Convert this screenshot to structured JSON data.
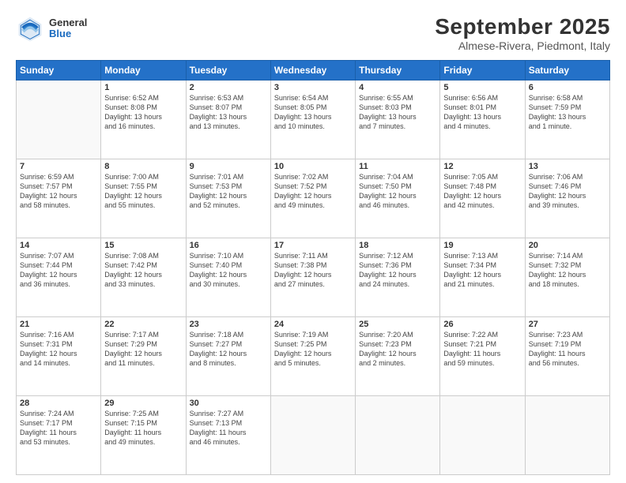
{
  "header": {
    "logo": {
      "general": "General",
      "blue": "Blue"
    },
    "title": "September 2025",
    "subtitle": "Almese-Rivera, Piedmont, Italy"
  },
  "days_of_week": [
    "Sunday",
    "Monday",
    "Tuesday",
    "Wednesday",
    "Thursday",
    "Friday",
    "Saturday"
  ],
  "weeks": [
    [
      {
        "day": "",
        "info": ""
      },
      {
        "day": "1",
        "info": "Sunrise: 6:52 AM\nSunset: 8:08 PM\nDaylight: 13 hours\nand 16 minutes."
      },
      {
        "day": "2",
        "info": "Sunrise: 6:53 AM\nSunset: 8:07 PM\nDaylight: 13 hours\nand 13 minutes."
      },
      {
        "day": "3",
        "info": "Sunrise: 6:54 AM\nSunset: 8:05 PM\nDaylight: 13 hours\nand 10 minutes."
      },
      {
        "day": "4",
        "info": "Sunrise: 6:55 AM\nSunset: 8:03 PM\nDaylight: 13 hours\nand 7 minutes."
      },
      {
        "day": "5",
        "info": "Sunrise: 6:56 AM\nSunset: 8:01 PM\nDaylight: 13 hours\nand 4 minutes."
      },
      {
        "day": "6",
        "info": "Sunrise: 6:58 AM\nSunset: 7:59 PM\nDaylight: 13 hours\nand 1 minute."
      }
    ],
    [
      {
        "day": "7",
        "info": "Sunrise: 6:59 AM\nSunset: 7:57 PM\nDaylight: 12 hours\nand 58 minutes."
      },
      {
        "day": "8",
        "info": "Sunrise: 7:00 AM\nSunset: 7:55 PM\nDaylight: 12 hours\nand 55 minutes."
      },
      {
        "day": "9",
        "info": "Sunrise: 7:01 AM\nSunset: 7:53 PM\nDaylight: 12 hours\nand 52 minutes."
      },
      {
        "day": "10",
        "info": "Sunrise: 7:02 AM\nSunset: 7:52 PM\nDaylight: 12 hours\nand 49 minutes."
      },
      {
        "day": "11",
        "info": "Sunrise: 7:04 AM\nSunset: 7:50 PM\nDaylight: 12 hours\nand 46 minutes."
      },
      {
        "day": "12",
        "info": "Sunrise: 7:05 AM\nSunset: 7:48 PM\nDaylight: 12 hours\nand 42 minutes."
      },
      {
        "day": "13",
        "info": "Sunrise: 7:06 AM\nSunset: 7:46 PM\nDaylight: 12 hours\nand 39 minutes."
      }
    ],
    [
      {
        "day": "14",
        "info": "Sunrise: 7:07 AM\nSunset: 7:44 PM\nDaylight: 12 hours\nand 36 minutes."
      },
      {
        "day": "15",
        "info": "Sunrise: 7:08 AM\nSunset: 7:42 PM\nDaylight: 12 hours\nand 33 minutes."
      },
      {
        "day": "16",
        "info": "Sunrise: 7:10 AM\nSunset: 7:40 PM\nDaylight: 12 hours\nand 30 minutes."
      },
      {
        "day": "17",
        "info": "Sunrise: 7:11 AM\nSunset: 7:38 PM\nDaylight: 12 hours\nand 27 minutes."
      },
      {
        "day": "18",
        "info": "Sunrise: 7:12 AM\nSunset: 7:36 PM\nDaylight: 12 hours\nand 24 minutes."
      },
      {
        "day": "19",
        "info": "Sunrise: 7:13 AM\nSunset: 7:34 PM\nDaylight: 12 hours\nand 21 minutes."
      },
      {
        "day": "20",
        "info": "Sunrise: 7:14 AM\nSunset: 7:32 PM\nDaylight: 12 hours\nand 18 minutes."
      }
    ],
    [
      {
        "day": "21",
        "info": "Sunrise: 7:16 AM\nSunset: 7:31 PM\nDaylight: 12 hours\nand 14 minutes."
      },
      {
        "day": "22",
        "info": "Sunrise: 7:17 AM\nSunset: 7:29 PM\nDaylight: 12 hours\nand 11 minutes."
      },
      {
        "day": "23",
        "info": "Sunrise: 7:18 AM\nSunset: 7:27 PM\nDaylight: 12 hours\nand 8 minutes."
      },
      {
        "day": "24",
        "info": "Sunrise: 7:19 AM\nSunset: 7:25 PM\nDaylight: 12 hours\nand 5 minutes."
      },
      {
        "day": "25",
        "info": "Sunrise: 7:20 AM\nSunset: 7:23 PM\nDaylight: 12 hours\nand 2 minutes."
      },
      {
        "day": "26",
        "info": "Sunrise: 7:22 AM\nSunset: 7:21 PM\nDaylight: 11 hours\nand 59 minutes."
      },
      {
        "day": "27",
        "info": "Sunrise: 7:23 AM\nSunset: 7:19 PM\nDaylight: 11 hours\nand 56 minutes."
      }
    ],
    [
      {
        "day": "28",
        "info": "Sunrise: 7:24 AM\nSunset: 7:17 PM\nDaylight: 11 hours\nand 53 minutes."
      },
      {
        "day": "29",
        "info": "Sunrise: 7:25 AM\nSunset: 7:15 PM\nDaylight: 11 hours\nand 49 minutes."
      },
      {
        "day": "30",
        "info": "Sunrise: 7:27 AM\nSunset: 7:13 PM\nDaylight: 11 hours\nand 46 minutes."
      },
      {
        "day": "",
        "info": ""
      },
      {
        "day": "",
        "info": ""
      },
      {
        "day": "",
        "info": ""
      },
      {
        "day": "",
        "info": ""
      }
    ]
  ]
}
